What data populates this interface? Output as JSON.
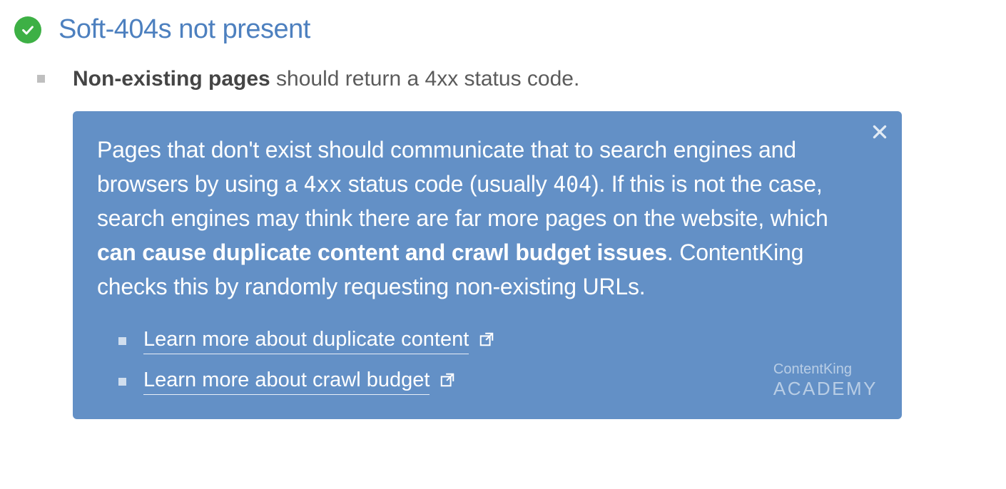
{
  "header": {
    "title": "Soft-404s not present"
  },
  "description": {
    "bold_part": "Non-existing pages",
    "rest": " should return a 4xx status code."
  },
  "infobox": {
    "p_a": "Pages that don't exist should communicate that to search engines and browsers by using a ",
    "p_code1": "4xx",
    "p_b": " status code (usually ",
    "p_code2": "404",
    "p_c": "). If this is not the case, search engines may think there are far more pages on the website, which ",
    "p_bold": "can cause duplicate content and crawl budget issues",
    "p_d": ". ContentKing checks this by randomly requesting non-existing URLs.",
    "links": [
      {
        "label": "Learn more about duplicate content"
      },
      {
        "label": "Learn more about crawl budget"
      }
    ],
    "brand_top": "ContentKing",
    "brand_bottom": "ACADEMY"
  }
}
